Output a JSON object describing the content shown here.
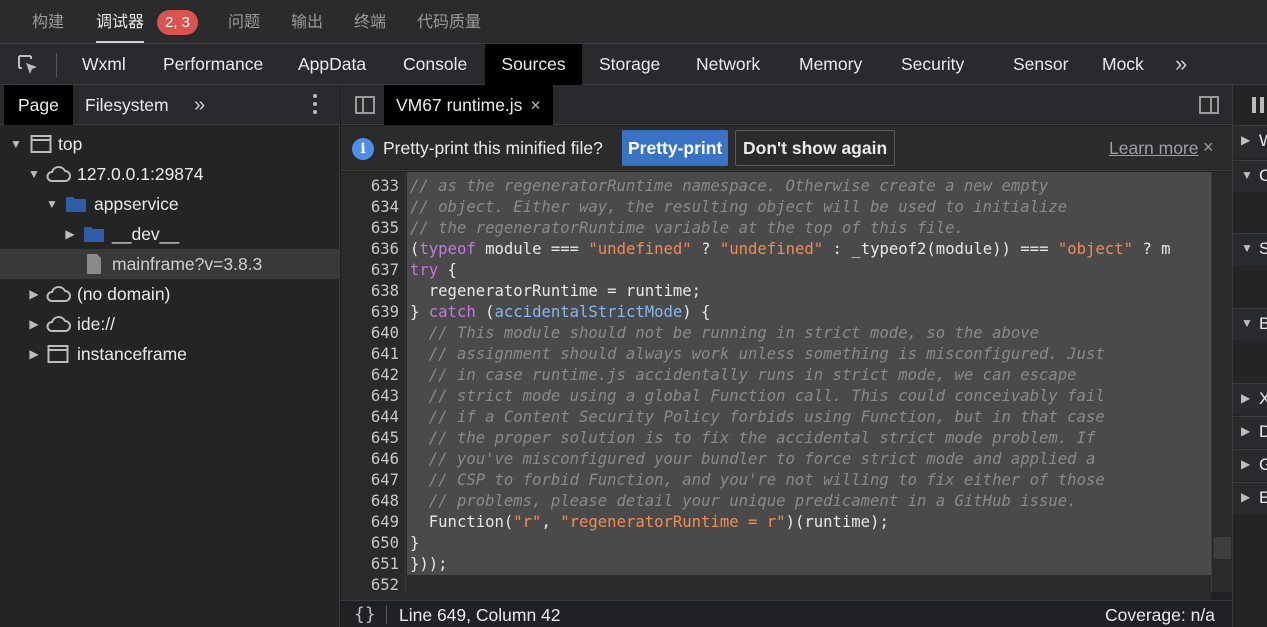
{
  "top_tabs": [
    {
      "label": "构建"
    },
    {
      "label": "调试器"
    },
    {
      "label": "问题"
    },
    {
      "label": "输出"
    },
    {
      "label": "终端"
    },
    {
      "label": "代码质量"
    }
  ],
  "debugger_badge": "2, 3",
  "devtools_tabs": [
    "Wxml",
    "Performance",
    "AppData",
    "Console",
    "Sources",
    "Storage",
    "Network",
    "Memory",
    "Security",
    "Sensor",
    "Mock"
  ],
  "devtools_more": "»",
  "left_panel": {
    "tabs": [
      "Page",
      "Filesystem"
    ],
    "more": "»",
    "tree": [
      {
        "label": "top",
        "icon": "frame-icon"
      },
      {
        "label": "127.0.0.1:29874",
        "icon": "cloud-icon"
      },
      {
        "label": "appservice",
        "icon": "folder-icon"
      },
      {
        "label": "__dev__",
        "icon": "folder-icon"
      },
      {
        "label": "mainframe?v=3.8.3",
        "icon": "file-icon"
      },
      {
        "label": "(no domain)",
        "icon": "cloud-icon"
      },
      {
        "label": "ide://",
        "icon": "cloud-icon"
      },
      {
        "label": "instanceframe",
        "icon": "frame-icon"
      }
    ]
  },
  "editor": {
    "tab_label": "VM67 runtime.js",
    "tab_close": "×",
    "infobar": {
      "text": "Pretty-print this minified file?",
      "primary": "Pretty-print",
      "secondary": "Don't show again",
      "learn_more": "Learn more",
      "close": "×"
    },
    "lines": [
      {
        "n": "633",
        "t": "// as the regeneratorRuntime namespace. Otherwise create a new empty"
      },
      {
        "n": "634",
        "t": "// object. Either way, the resulting object will be used to initialize"
      },
      {
        "n": "635",
        "t": "// the regeneratorRuntime variable at the top of this file."
      },
      {
        "n": "636",
        "t": "(typeof module === \"undefined\" ? \"undefined\" : _typeof2(module)) === \"object\" ? m"
      },
      {
        "n": "637",
        "t": "try {"
      },
      {
        "n": "638",
        "t": "  regeneratorRuntime = runtime;"
      },
      {
        "n": "639",
        "t": "} catch (accidentalStrictMode) {"
      },
      {
        "n": "640",
        "t": "  // This module should not be running in strict mode, so the above"
      },
      {
        "n": "641",
        "t": "  // assignment should always work unless something is misconfigured. Just"
      },
      {
        "n": "642",
        "t": "  // in case runtime.js accidentally runs in strict mode, we can escape"
      },
      {
        "n": "643",
        "t": "  // strict mode using a global Function call. This could conceivably fail"
      },
      {
        "n": "644",
        "t": "  // if a Content Security Policy forbids using Function, but in that case"
      },
      {
        "n": "645",
        "t": "  // the proper solution is to fix the accidental strict mode problem. If"
      },
      {
        "n": "646",
        "t": "  // you've misconfigured your bundler to force strict mode and applied a"
      },
      {
        "n": "647",
        "t": "  // CSP to forbid Function, and you're not willing to fix either of those"
      },
      {
        "n": "648",
        "t": "  // problems, please detail your unique predicament in a GitHub issue."
      },
      {
        "n": "649",
        "t": "  Function(\"r\", \"regeneratorRuntime = r\")(runtime);"
      },
      {
        "n": "650",
        "t": "}"
      },
      {
        "n": "651",
        "t": "}));"
      },
      {
        "n": "652",
        "t": ""
      }
    ],
    "status": {
      "braces": "{}",
      "position": "Line 649, Column 42",
      "coverage": "Coverage: n/a"
    }
  },
  "right_panel": {
    "rows": [
      "W",
      "C",
      "S",
      "B",
      "X",
      "D",
      "G",
      "E"
    ]
  },
  "colors": {
    "accent": "#3a73c4",
    "badge": "#d9534f",
    "info": "#4f8ee8"
  }
}
